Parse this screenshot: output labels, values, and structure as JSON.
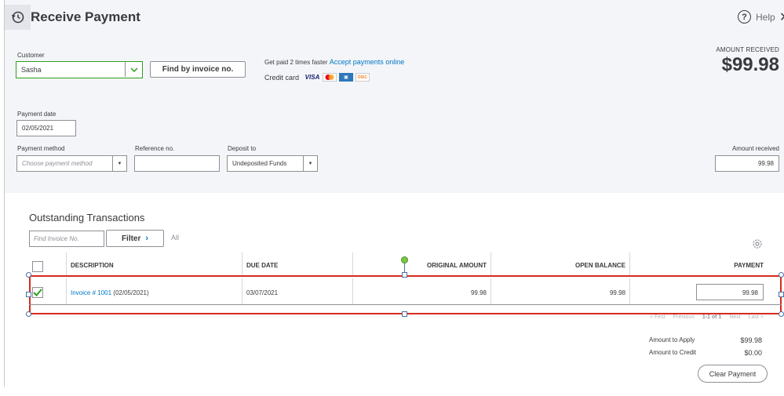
{
  "header": {
    "title": "Receive Payment",
    "help_label": "Help",
    "history_icon": "history-clock-icon",
    "close_icon": "close-icon"
  },
  "amount_received_banner": {
    "label": "AMOUNT RECEIVED",
    "value": "$99.98"
  },
  "customer": {
    "label": "Customer",
    "value": "Sasha",
    "find_button": "Find by invoice no."
  },
  "promo": {
    "text": "Get paid 2 times faster",
    "link": "Accept payments online",
    "credit_card_label": "Credit card",
    "cards": [
      "VISA",
      "MasterCard",
      "AMEX",
      "DISCOVER"
    ]
  },
  "payment_date": {
    "label": "Payment date",
    "value": "02/05/2021"
  },
  "payment_method": {
    "label": "Payment method",
    "placeholder": "Choose payment method"
  },
  "reference_no": {
    "label": "Reference no.",
    "value": ""
  },
  "deposit_to": {
    "label": "Deposit to",
    "value": "Undeposited Funds"
  },
  "amount_received_field": {
    "label": "Amount received",
    "value": "99.98"
  },
  "outstanding": {
    "title": "Outstanding Transactions",
    "find_placeholder": "Find Invoice No.",
    "filter_label": "Filter",
    "all_label": "All",
    "columns": {
      "description": "DESCRIPTION",
      "due_date": "DUE DATE",
      "original_amount": "ORIGINAL AMOUNT",
      "open_balance": "OPEN BALANCE",
      "payment": "PAYMENT"
    },
    "rows": [
      {
        "checked": true,
        "invoice_link": "Invoice # 1001",
        "invoice_date": "(02/05/2021)",
        "due_date": "03/07/2021",
        "original_amount": "99.98",
        "open_balance": "99.98",
        "payment": "99.98"
      }
    ],
    "pagination": {
      "first": "< First",
      "previous": "Previous",
      "range": "1-1 of 1",
      "next": "Next",
      "last": "Last >"
    }
  },
  "summary": {
    "amount_to_apply_label": "Amount to Apply",
    "amount_to_apply_value": "$99.98",
    "amount_to_credit_label": "Amount to Credit",
    "amount_to_credit_value": "$0.00",
    "clear_button": "Clear Payment"
  },
  "colors": {
    "accent_green": "#2ca01c",
    "link_blue": "#0077c5",
    "selection_red": "#d52b1e",
    "panel_bg": "#f4f5f8"
  }
}
